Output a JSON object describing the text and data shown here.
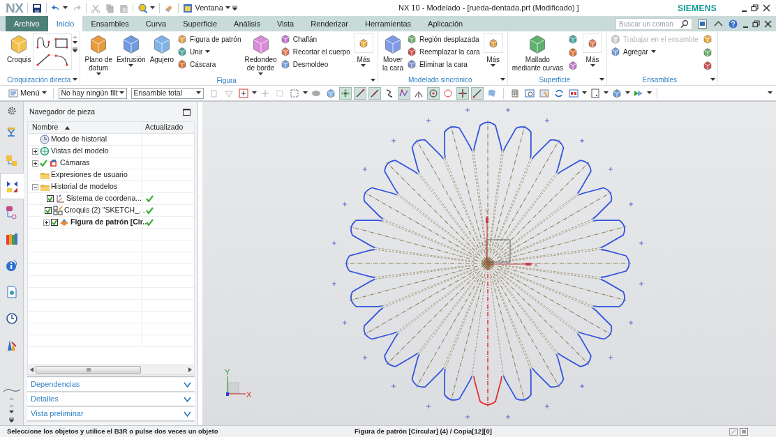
{
  "titlebar": {
    "logo": "NX",
    "window_menu": "Ventana",
    "title": "NX 10 - Modelado - [rueda-dentada.prt (Modificado) ]",
    "brand": "SIEMENS"
  },
  "tabs": [
    {
      "label": "Archivo",
      "kind": "file",
      "selected": false
    },
    {
      "label": "Inicio",
      "kind": "tab",
      "selected": true
    },
    {
      "label": "Ensambles",
      "kind": "tab",
      "selected": false
    },
    {
      "label": "Curva",
      "kind": "tab",
      "selected": false
    },
    {
      "label": "Superficie",
      "kind": "tab",
      "selected": false
    },
    {
      "label": "Análisis",
      "kind": "tab",
      "selected": false
    },
    {
      "label": "Vista",
      "kind": "tab",
      "selected": false
    },
    {
      "label": "Renderizar",
      "kind": "tab",
      "selected": false
    },
    {
      "label": "Herramientas",
      "kind": "tab",
      "selected": false
    },
    {
      "label": "Aplicación",
      "kind": "tab",
      "selected": false
    }
  ],
  "search": {
    "placeholder": "Buscar un coman"
  },
  "ribbon": [
    {
      "label": "Croquización directa",
      "items": [
        {
          "kind": "large",
          "label": "Croquis",
          "dropdown": false
        },
        {
          "kind": "sketch-tools"
        }
      ]
    },
    {
      "label": "Figura",
      "items": [
        {
          "kind": "large",
          "label": "Plano de\ndatum",
          "dropdown": true
        },
        {
          "kind": "large",
          "label": "Extrusión",
          "dropdown": true
        },
        {
          "kind": "large",
          "label": "Agujero",
          "dropdown": false
        },
        {
          "kind": "stack",
          "items": [
            {
              "label": "Figura de patrón",
              "dropdown": false,
              "disabled": false
            },
            {
              "label": "Unir",
              "dropdown": true,
              "disabled": false
            },
            {
              "label": "Cáscara",
              "dropdown": false,
              "disabled": false
            }
          ]
        },
        {
          "kind": "large",
          "label": "Redondeo\nde borde",
          "dropdown": true
        },
        {
          "kind": "stack",
          "items": [
            {
              "label": "Chaflán",
              "dropdown": false,
              "disabled": false
            },
            {
              "label": "Recortar el cuerpo",
              "dropdown": false,
              "disabled": false
            },
            {
              "label": "Desmoldeo",
              "dropdown": false,
              "disabled": false
            }
          ]
        },
        {
          "kind": "more",
          "label": "Más"
        }
      ]
    },
    {
      "label": "Modelado sincrónico",
      "items": [
        {
          "kind": "large",
          "label": "Mover\nla cara",
          "dropdown": false
        },
        {
          "kind": "stack",
          "items": [
            {
              "label": "Región desplazada",
              "dropdown": false,
              "disabled": false
            },
            {
              "label": "Reemplazar la cara",
              "dropdown": false,
              "disabled": false
            },
            {
              "label": "Eliminar la cara",
              "dropdown": false,
              "disabled": false
            }
          ]
        },
        {
          "kind": "more",
          "label": "Más"
        }
      ]
    },
    {
      "label": "Superficie",
      "items": [
        {
          "kind": "large",
          "label": "Mallado\nmediante curvas",
          "dropdown": false
        },
        {
          "kind": "icon-column"
        },
        {
          "kind": "more",
          "label": "Más"
        }
      ]
    },
    {
      "label": "Ensambles",
      "items": [
        {
          "kind": "stack",
          "items": [
            {
              "label": "Trabajar en el ensamble",
              "dropdown": false,
              "disabled": true
            },
            {
              "label": "Agregar",
              "dropdown": true,
              "disabled": false
            }
          ]
        },
        {
          "kind": "icon-column"
        }
      ]
    }
  ],
  "toolbar": {
    "menu": "Menú",
    "filters": [
      "No hay ningún filt",
      "Ensamble total"
    ],
    "tools": [
      {
        "on": false
      },
      {
        "on": false
      },
      {
        "on": false
      },
      {
        "on": false
      },
      {
        "on": false
      },
      {
        "on": false
      },
      {
        "on": false
      },
      {
        "on": false
      },
      {
        "on": true
      },
      {
        "on": true
      },
      {
        "on": true
      },
      {
        "on": false
      },
      {
        "on": true
      },
      {
        "on": false
      },
      {
        "on": true
      },
      {
        "on": false
      },
      {
        "on": true
      },
      {
        "on": true
      },
      {
        "on": false
      },
      {
        "on": false
      },
      {
        "on": false
      },
      {
        "on": false
      },
      {
        "on": false
      },
      {
        "on": false
      },
      {
        "on": false
      },
      {
        "on": false
      },
      {
        "on": false
      }
    ]
  },
  "resource_bar": [
    {
      "selected": false
    },
    {
      "selected": false
    },
    {
      "selected": true
    },
    {
      "selected": false
    },
    {
      "selected": false
    },
    {
      "selected": false
    },
    {
      "selected": false
    },
    {
      "selected": false
    },
    {
      "selected": false
    }
  ],
  "navigator": {
    "title": "Navegador de pieza",
    "columns": [
      "Nombre",
      "Actualizado"
    ],
    "tree": [
      {
        "label": "Modo de historial",
        "active": false,
        "expandable": false
      },
      {
        "label": "Vistas del modelo",
        "active": false,
        "expandable": true,
        "expanded": false
      },
      {
        "label": "Cámaras",
        "active": true,
        "expandable": true,
        "expanded": false
      },
      {
        "label": "Expresiones de usuario",
        "active": false,
        "expandable": false
      },
      {
        "label": "Historial de modelos",
        "active": false,
        "expandable": true,
        "expanded": true,
        "children": [
          {
            "label": "Sistema de coordena...",
            "checked": true,
            "updated": true,
            "current": false,
            "expandable": false
          },
          {
            "label": "Croquis (2) \"SKETCH_...",
            "checked": true,
            "updated": true,
            "current": false,
            "expandable": false
          },
          {
            "label": "Figura de patrón [Cir...",
            "checked": true,
            "updated": true,
            "current": true,
            "expandable": true
          }
        ]
      }
    ],
    "panels": [
      {
        "label": "Dependencias",
        "expanded": false
      },
      {
        "label": "Detalles",
        "expanded": false
      },
      {
        "label": "Vista preliminar",
        "expanded": false
      }
    ]
  },
  "viewport": {
    "triad_labels": [
      "Y",
      "X"
    ],
    "origin_labels": [
      "Y",
      "X"
    ]
  },
  "status_bar": {
    "prompt": "Seleccione los objetos y utilice el B3R o pulse dos veces un objeto",
    "selection": "Figura de patrón [Circular] (4) / Copia[12][0]"
  }
}
